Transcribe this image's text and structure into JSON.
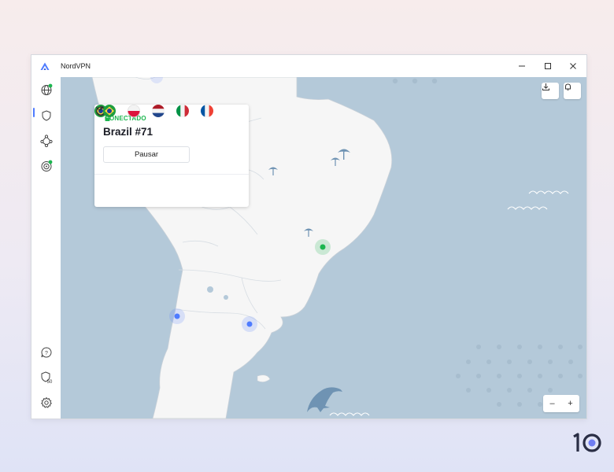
{
  "window": {
    "app_title": "NordVPN"
  },
  "connection": {
    "status": "CONECTADO",
    "server": "Brazil #71",
    "pause_label": "Pausar",
    "recent_flags": [
      "brazil-flag-icon",
      "poland-flag-icon",
      "netherlands-flag-icon",
      "italy-flag-icon",
      "france-flag-icon"
    ]
  },
  "sidebar": {
    "items": [
      "globe-icon",
      "shield-icon",
      "meshnet-icon",
      "target-icon",
      "help-icon",
      "shield-50-icon",
      "settings-icon"
    ],
    "badge_text": "50"
  },
  "zoom": {
    "minus": "–",
    "plus": "+"
  },
  "colors": {
    "accent": "#4f7cff",
    "connected": "#1cb64f",
    "ocean": "#b4c9d9",
    "land": "#f6f6f6"
  }
}
